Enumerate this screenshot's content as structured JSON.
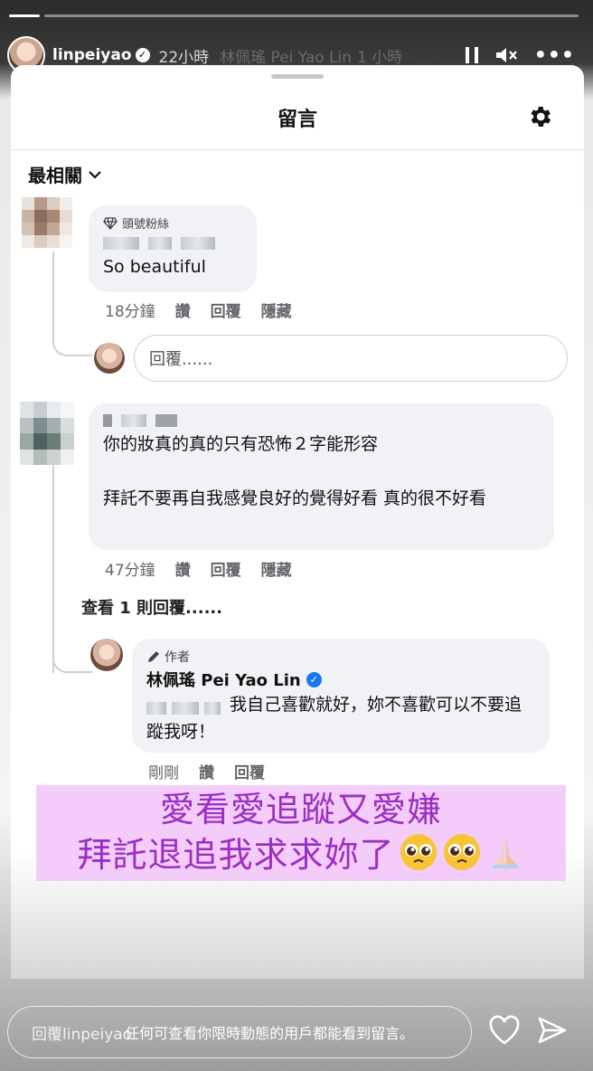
{
  "story": {
    "username": "linpeiyao",
    "time": "22小時",
    "ghost_text": "林佩瑤 Pei Yao Lin",
    "ghost_time": "1 小時"
  },
  "sheet": {
    "title": "留言",
    "sort_label": "最相關"
  },
  "comments": [
    {
      "badge": "頭號粉絲",
      "text": "So beautiful",
      "time": "18分鐘",
      "actions": [
        "讚",
        "回覆",
        "隱藏"
      ]
    },
    {
      "text_line1": "你的妝真的真的只有恐怖２字能形容",
      "text_line2": "拜託不要再自我感覺良好的覺得好看 真的很不好看",
      "time": "47分鐘",
      "actions": [
        "讚",
        "回覆",
        "隱藏"
      ],
      "view_replies": "查看 1 則回覆......"
    }
  ],
  "reply_input": {
    "placeholder": "回覆......"
  },
  "author_reply": {
    "tag": "作者",
    "name": "林佩瑤 Pei Yao Lin",
    "text": "我自己喜歡就好，妳不喜歡可以不要追蹤我呀！",
    "time": "剛剛",
    "actions": [
      "讚",
      "回覆"
    ]
  },
  "overlay": {
    "line1": "愛看愛追蹤又愛嫌",
    "line2": "拜託退追我求求妳了"
  },
  "bottom_bar": {
    "reply_placeholder": "回覆linpeiyao",
    "overlap_text": "任何可查看你限時動態的用戶都能看到留言。"
  },
  "colors": {
    "overlay_bg": "#f4ccfa",
    "overlay_text": "#9b2fc4",
    "verified_blue": "#1877f2"
  }
}
